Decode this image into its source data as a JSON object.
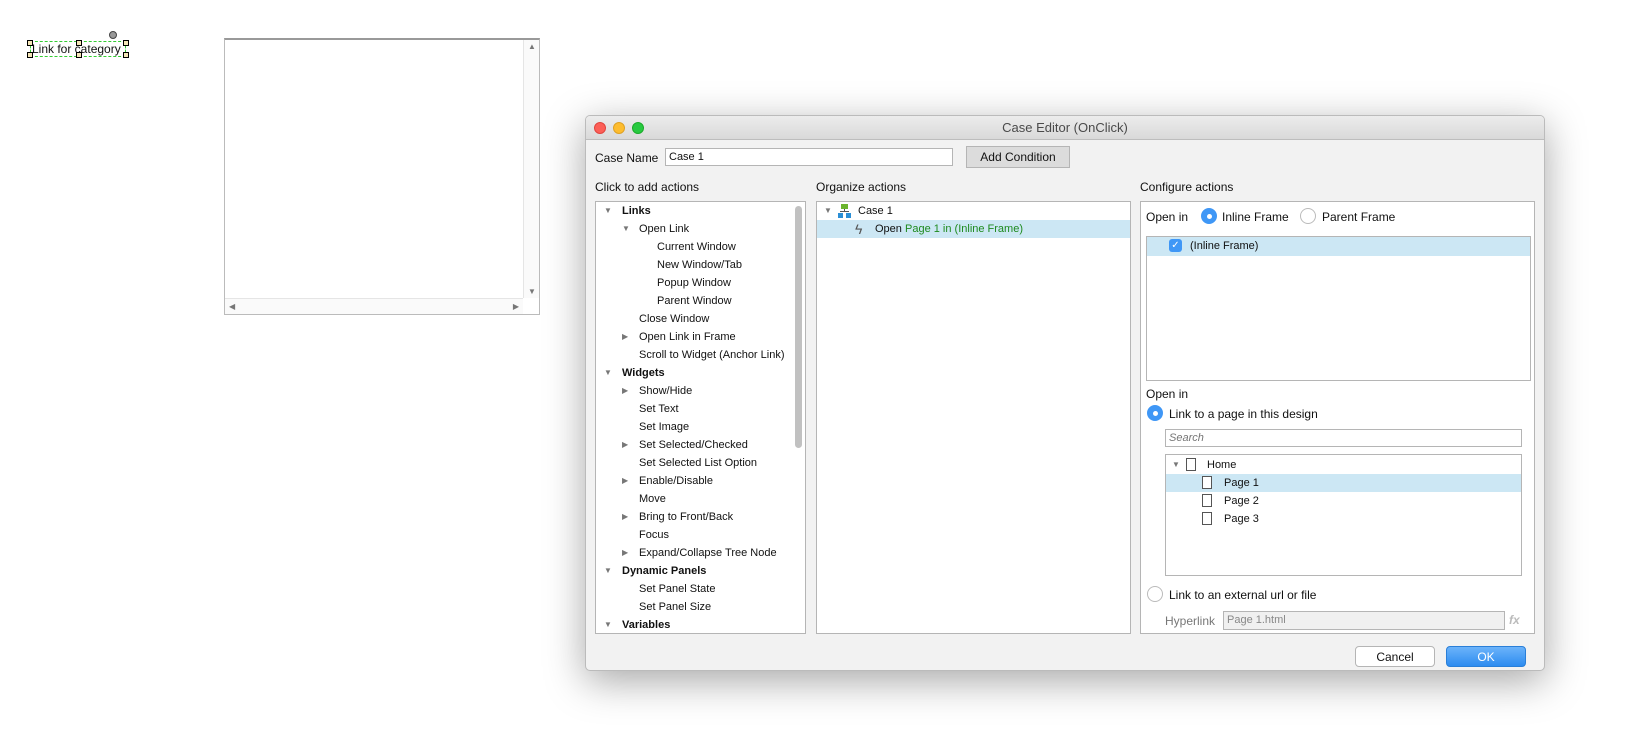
{
  "canvas": {
    "widget_text": "Link for category"
  },
  "dialog": {
    "title": "Case Editor (OnClick)",
    "case_name_label": "Case Name",
    "case_name_value": "Case 1",
    "add_condition": "Add Condition",
    "col_add": "Click to add actions",
    "col_organize": "Organize actions",
    "col_configure": "Configure actions",
    "actions": [
      {
        "label": "Links",
        "level": 0,
        "bold": true,
        "toggle": "open"
      },
      {
        "label": "Open Link",
        "level": 1,
        "toggle": "open"
      },
      {
        "label": "Current Window",
        "level": 2
      },
      {
        "label": "New Window/Tab",
        "level": 2
      },
      {
        "label": "Popup Window",
        "level": 2
      },
      {
        "label": "Parent Window",
        "level": 2
      },
      {
        "label": "Close Window",
        "level": 1
      },
      {
        "label": "Open Link in Frame",
        "level": 1,
        "toggle": "closed"
      },
      {
        "label": "Scroll to Widget (Anchor Link)",
        "level": 1
      },
      {
        "label": "Widgets",
        "level": 0,
        "bold": true,
        "toggle": "open"
      },
      {
        "label": "Show/Hide",
        "level": 1,
        "toggle": "closed"
      },
      {
        "label": "Set Text",
        "level": 1
      },
      {
        "label": "Set Image",
        "level": 1
      },
      {
        "label": "Set Selected/Checked",
        "level": 1,
        "toggle": "closed"
      },
      {
        "label": "Set Selected List Option",
        "level": 1
      },
      {
        "label": "Enable/Disable",
        "level": 1,
        "toggle": "closed"
      },
      {
        "label": "Move",
        "level": 1
      },
      {
        "label": "Bring to Front/Back",
        "level": 1,
        "toggle": "closed"
      },
      {
        "label": "Focus",
        "level": 1
      },
      {
        "label": "Expand/Collapse Tree Node",
        "level": 1,
        "toggle": "closed"
      },
      {
        "label": "Dynamic Panels",
        "level": 0,
        "bold": true,
        "toggle": "open"
      },
      {
        "label": "Set Panel State",
        "level": 1
      },
      {
        "label": "Set Panel Size",
        "level": 1
      },
      {
        "label": "Variables",
        "level": 0,
        "bold": true,
        "toggle": "open"
      }
    ],
    "organize": {
      "case": "Case 1",
      "action_verb": "Open",
      "action_detail": "Page 1 in (Inline Frame)"
    },
    "configure": {
      "open_in_label": "Open in",
      "inline_frame": "Inline Frame",
      "parent_frame": "Parent Frame",
      "frame_item": "(Inline Frame)",
      "frame_checked": true,
      "open_in_label2": "Open in",
      "link_page": "Link to a page in this design",
      "search_placeholder": "Search",
      "pages": [
        {
          "label": "Home",
          "level": 0
        },
        {
          "label": "Page 1",
          "level": 1,
          "selected": true
        },
        {
          "label": "Page 2",
          "level": 1
        },
        {
          "label": "Page 3",
          "level": 1
        }
      ],
      "link_external": "Link to an external url or file",
      "hyperlink_label": "Hyperlink",
      "hyperlink_value": "Page 1.html",
      "fx": "fx"
    },
    "cancel": "Cancel",
    "ok": "OK"
  },
  "colors": {
    "accent": "#3f97f6",
    "selection": "#cce7f4",
    "green_text": "#1e8a1e"
  }
}
